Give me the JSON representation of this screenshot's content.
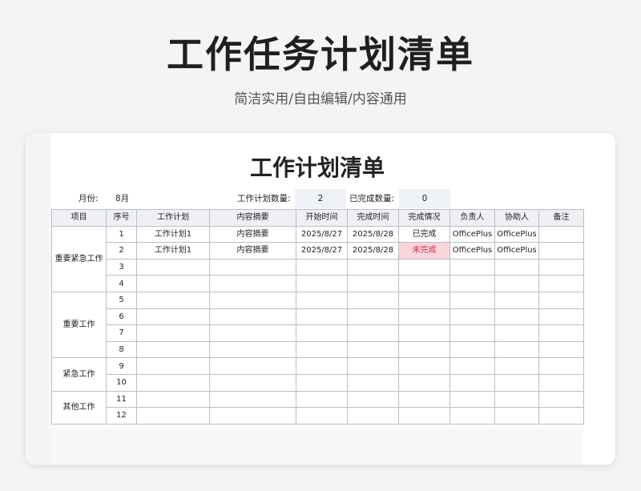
{
  "page": {
    "title": "工作任务计划清单",
    "subtitle": "简洁实用/自由编辑/内容通用"
  },
  "sheet": {
    "title": "工作计划清单",
    "month_label": "月份:",
    "month_value": "8月",
    "plan_count_label": "工作计划数量:",
    "plan_count_value": "2",
    "done_count_label": "已完成数量:",
    "done_count_value": "0"
  },
  "table": {
    "headers": [
      "项目",
      "序号",
      "工作计划",
      "内容摘要",
      "开始时间",
      "完成时间",
      "完成情况",
      "负责人",
      "协助人",
      "备注"
    ],
    "categories": [
      {
        "name": "重要紧急工作",
        "rows": [
          1,
          2,
          3,
          4
        ]
      },
      {
        "name": "重要工作",
        "rows": [
          5,
          6,
          7,
          8
        ]
      },
      {
        "name": "紧急工作",
        "rows": [
          9,
          10
        ]
      },
      {
        "name": "其他工作",
        "rows": [
          11,
          12
        ]
      }
    ],
    "rows": [
      {
        "no": "1",
        "plan": "工作计划1",
        "summary": "内容摘要",
        "start": "2025/8/27",
        "end": "2025/8/28",
        "status": "已完成",
        "owner": "OfficePlus",
        "assist": "OfficePlus",
        "note": ""
      },
      {
        "no": "2",
        "plan": "工作计划1",
        "summary": "内容摘要",
        "start": "2025/8/27",
        "end": "2025/8/28",
        "status": "未完成",
        "owner": "OfficePlus",
        "assist": "OfficePlus",
        "note": ""
      },
      {
        "no": "3",
        "plan": "",
        "summary": "",
        "start": "",
        "end": "",
        "status": "",
        "owner": "",
        "assist": "",
        "note": ""
      },
      {
        "no": "4",
        "plan": "",
        "summary": "",
        "start": "",
        "end": "",
        "status": "",
        "owner": "",
        "assist": "",
        "note": ""
      },
      {
        "no": "5",
        "plan": "",
        "summary": "",
        "start": "",
        "end": "",
        "status": "",
        "owner": "",
        "assist": "",
        "note": ""
      },
      {
        "no": "6",
        "plan": "",
        "summary": "",
        "start": "",
        "end": "",
        "status": "",
        "owner": "",
        "assist": "",
        "note": ""
      },
      {
        "no": "7",
        "plan": "",
        "summary": "",
        "start": "",
        "end": "",
        "status": "",
        "owner": "",
        "assist": "",
        "note": ""
      },
      {
        "no": "8",
        "plan": "",
        "summary": "",
        "start": "",
        "end": "",
        "status": "",
        "owner": "",
        "assist": "",
        "note": ""
      },
      {
        "no": "9",
        "plan": "",
        "summary": "",
        "start": "",
        "end": "",
        "status": "",
        "owner": "",
        "assist": "",
        "note": ""
      },
      {
        "no": "10",
        "plan": "",
        "summary": "",
        "start": "",
        "end": "",
        "status": "",
        "owner": "",
        "assist": "",
        "note": ""
      },
      {
        "no": "11",
        "plan": "",
        "summary": "",
        "start": "",
        "end": "",
        "status": "",
        "owner": "",
        "assist": "",
        "note": ""
      },
      {
        "no": "12",
        "plan": "",
        "summary": "",
        "start": "",
        "end": "",
        "status": "",
        "owner": "",
        "assist": "",
        "note": ""
      }
    ]
  },
  "colors": {
    "pending_bg": "#fbd5dc",
    "pending_text": "#d0303c",
    "header_bg": "#eef0f4"
  }
}
